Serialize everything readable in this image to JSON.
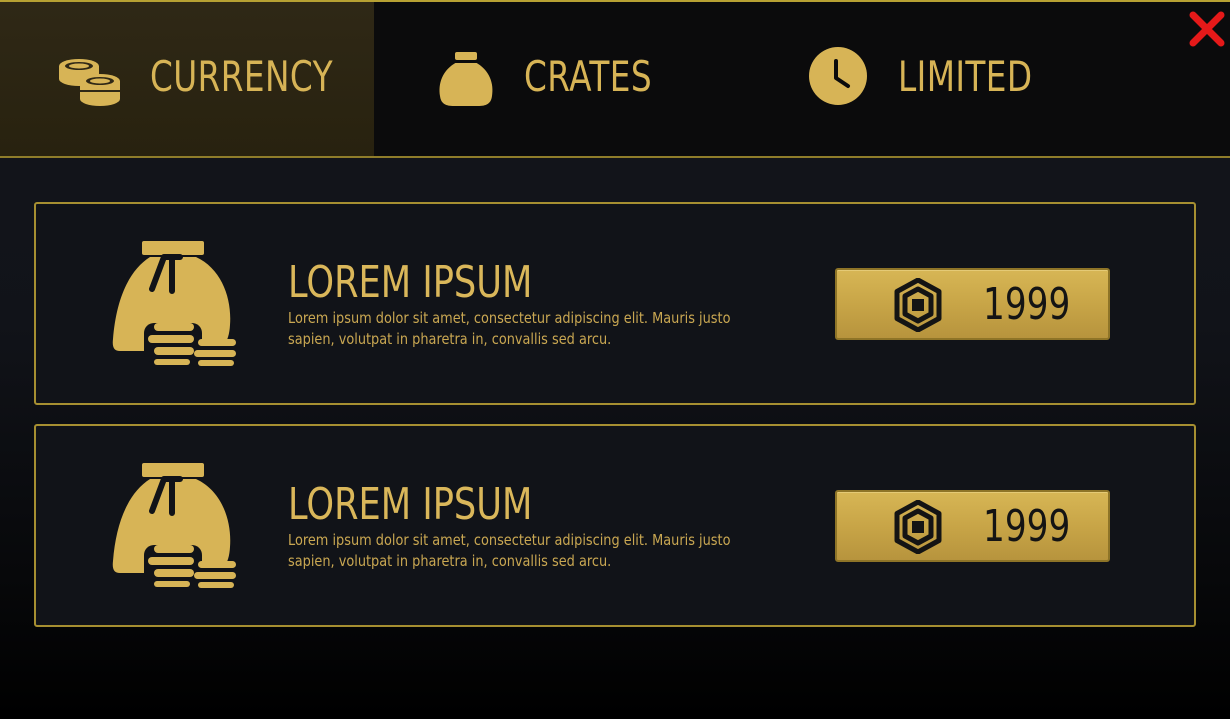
{
  "tabs": [
    {
      "label": "CURRENCY",
      "icon": "coins-icon",
      "active": true
    },
    {
      "label": "CRATES",
      "icon": "money-bag-icon",
      "active": false
    },
    {
      "label": "LIMITED",
      "icon": "clock-icon",
      "active": false
    }
  ],
  "close_icon": "close-icon",
  "items": [
    {
      "title": "LOREM IPSUM",
      "description": "Lorem ipsum dolor sit amet, consectetur adipiscing elit. Mauris justo sapien, volutpat in pharetra in, convallis sed arcu.",
      "price": "1999",
      "icon": "money-bag-coins-icon",
      "currency_icon": "robux-icon"
    },
    {
      "title": "LOREM IPSUM",
      "description": "Lorem ipsum dolor sit amet, consectetur adipiscing elit. Mauris justo sapien, volutpat in pharetra in, convallis sed arcu.",
      "price": "1999",
      "icon": "money-bag-coins-icon",
      "currency_icon": "robux-icon"
    }
  ],
  "colors": {
    "accent_gold": "#d7b456",
    "border_gold": "#a68f31",
    "card_bg": "#111318",
    "close_red": "#e51919"
  }
}
